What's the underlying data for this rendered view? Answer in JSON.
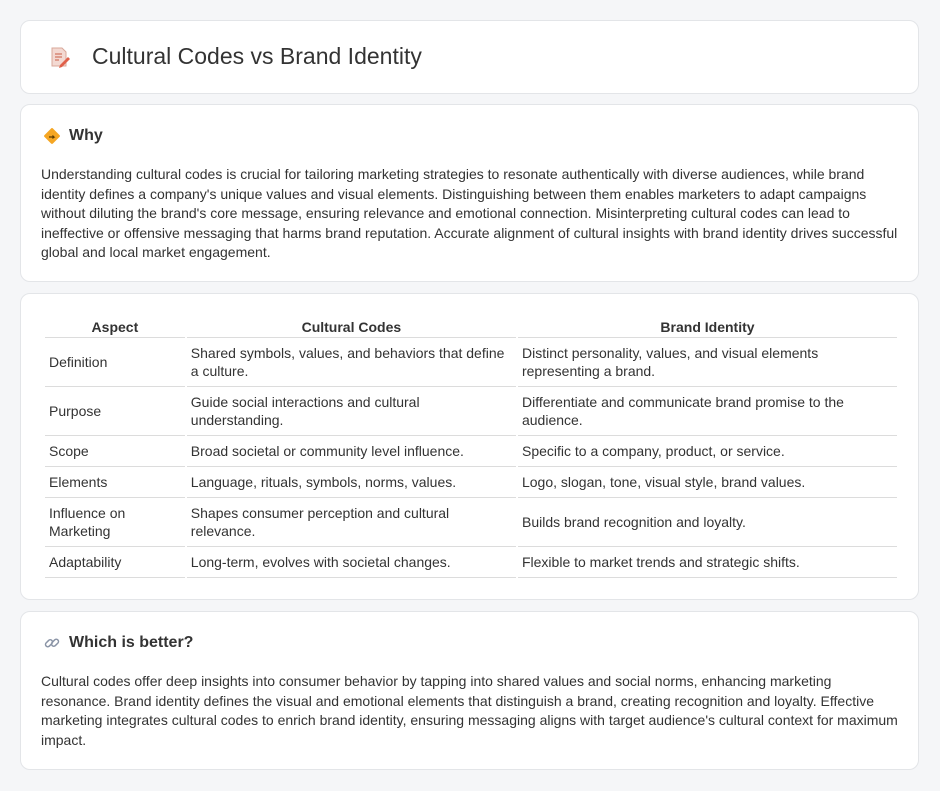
{
  "header": {
    "title": "Cultural Codes vs Brand Identity",
    "icon": "document-pencil-icon"
  },
  "why": {
    "heading": "Why",
    "icon": "diamond-sign-icon",
    "text": "Understanding cultural codes is crucial for tailoring marketing strategies to resonate authentically with diverse audiences, while brand identity defines a company's unique values and visual elements. Distinguishing between them enables marketers to adapt campaigns without diluting the brand's core message, ensuring relevance and emotional connection. Misinterpreting cultural codes can lead to ineffective or offensive messaging that harms brand reputation. Accurate alignment of cultural insights with brand identity drives successful global and local market engagement."
  },
  "table": {
    "headers": [
      "Aspect",
      "Cultural Codes",
      "Brand Identity"
    ],
    "rows": [
      [
        "Definition",
        "Shared symbols, values, and behaviors that define a culture.",
        "Distinct personality, values, and visual elements representing a brand."
      ],
      [
        "Purpose",
        "Guide social interactions and cultural understanding.",
        "Differentiate and communicate brand promise to the audience."
      ],
      [
        "Scope",
        "Broad societal or community level influence.",
        "Specific to a company, product, or service."
      ],
      [
        "Elements",
        "Language, rituals, symbols, norms, values.",
        "Logo, slogan, tone, visual style, brand values."
      ],
      [
        "Influence on Marketing",
        "Shapes consumer perception and cultural relevance.",
        "Builds brand recognition and loyalty."
      ],
      [
        "Adaptability",
        "Long-term, evolves with societal changes.",
        "Flexible to market trends and strategic shifts."
      ]
    ]
  },
  "better": {
    "heading": "Which is better?",
    "icon": "link-icon",
    "text": "Cultural codes offer deep insights into consumer behavior by tapping into shared values and social norms, enhancing marketing resonance. Brand identity defines the visual and emotional elements that distinguish a brand, creating recognition and loyalty. Effective marketing integrates cultural codes to enrich brand identity, ensuring messaging aligns with target audience's cultural context for maximum impact."
  },
  "colors": {
    "accent_orange": "#f5a623",
    "icon_red": "#e0604a",
    "link_gray": "#8a94a6"
  }
}
